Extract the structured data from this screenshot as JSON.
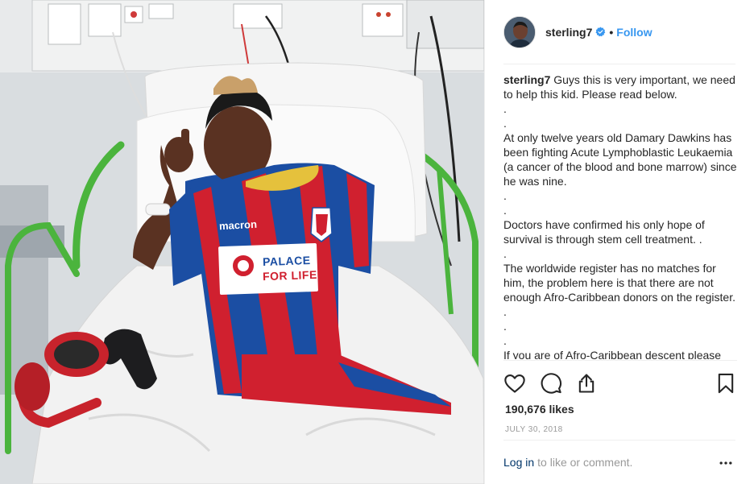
{
  "post": {
    "username": "sterling7",
    "dot": "•",
    "follow_label": "Follow",
    "caption_user": "sterling7",
    "caption_lines": [
      "Guys this is very important, we need to help this kid. Please read below.",
      ".",
      ".",
      "At only twelve years old Damary Dawkins has been fighting Acute Lymphoblastic Leukaemia (a cancer of the blood and bone marrow) since he was nine.",
      ".",
      ".",
      "Doctors have confirmed his only hope of survival is through stem cell treatment. .",
      ".",
      "The worldwide register has no matches for him, the problem here is that there are not enough Afro-Caribbean donors on the register. .",
      ".",
      ".",
      "If you are of Afro-Caribbean descent please"
    ],
    "likes": "190,676 likes",
    "date": "JULY 30, 2018",
    "login_link": "Log in",
    "login_rest": "to like or comment."
  },
  "shirt": {
    "brand": "macron",
    "sponsor_line1": "PALACE",
    "sponsor_line2": "FOR LIFE",
    "palace_red": "#d0202f",
    "palace_blue": "#1b4ea3"
  },
  "icons": {
    "like": "heart-icon",
    "comment": "comment-icon",
    "share": "share-icon",
    "save": "bookmark-icon",
    "more": "more-icon",
    "verified": "verified-badge-icon"
  },
  "colors": {
    "link_blue": "#3897f0",
    "text": "#262626",
    "muted": "#999999",
    "login": "#003569"
  }
}
